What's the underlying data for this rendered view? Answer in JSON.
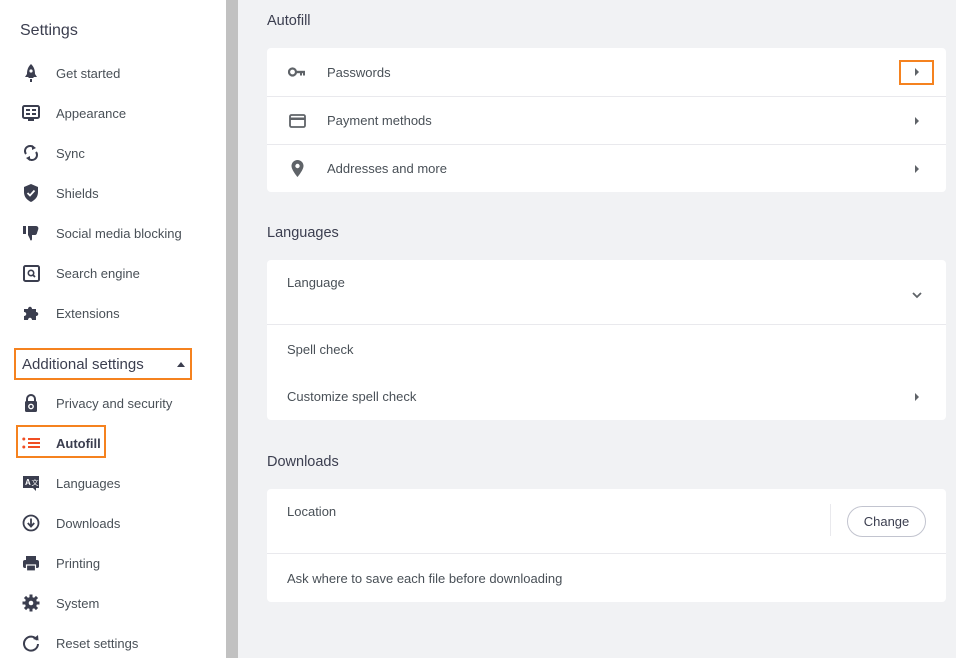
{
  "sidebar": {
    "title": "Settings",
    "items": [
      {
        "label": "Get started",
        "icon": "rocket-icon"
      },
      {
        "label": "Appearance",
        "icon": "appearance-icon"
      },
      {
        "label": "Sync",
        "icon": "sync-icon"
      },
      {
        "label": "Shields",
        "icon": "shield-icon"
      },
      {
        "label": "Social media blocking",
        "icon": "thumbs-down-icon"
      },
      {
        "label": "Search engine",
        "icon": "search-engine-icon"
      },
      {
        "label": "Extensions",
        "icon": "puzzle-icon"
      }
    ],
    "additional_label": "Additional settings",
    "additional_items": [
      {
        "label": "Privacy and security",
        "icon": "lock-icon"
      },
      {
        "label": "Autofill",
        "icon": "autofill-list-icon",
        "active": true
      },
      {
        "label": "Languages",
        "icon": "languages-icon"
      },
      {
        "label": "Downloads",
        "icon": "download-icon"
      },
      {
        "label": "Printing",
        "icon": "printer-icon"
      },
      {
        "label": "System",
        "icon": "gear-icon"
      },
      {
        "label": "Reset settings",
        "icon": "reset-icon"
      }
    ]
  },
  "colors": {
    "highlight": "#f5821f",
    "active_icon": "#f04e23"
  },
  "autofill": {
    "title": "Autofill",
    "rows": [
      {
        "label": "Passwords",
        "icon": "key-icon"
      },
      {
        "label": "Payment methods",
        "icon": "credit-card-icon"
      },
      {
        "label": "Addresses and more",
        "icon": "location-pin-icon"
      }
    ]
  },
  "languages": {
    "title": "Languages",
    "language_label": "Language",
    "spell_check_label": "Spell check",
    "customize_label": "Customize spell check"
  },
  "downloads": {
    "title": "Downloads",
    "location_label": "Location",
    "change_label": "Change",
    "ask_label": "Ask where to save each file before downloading"
  }
}
